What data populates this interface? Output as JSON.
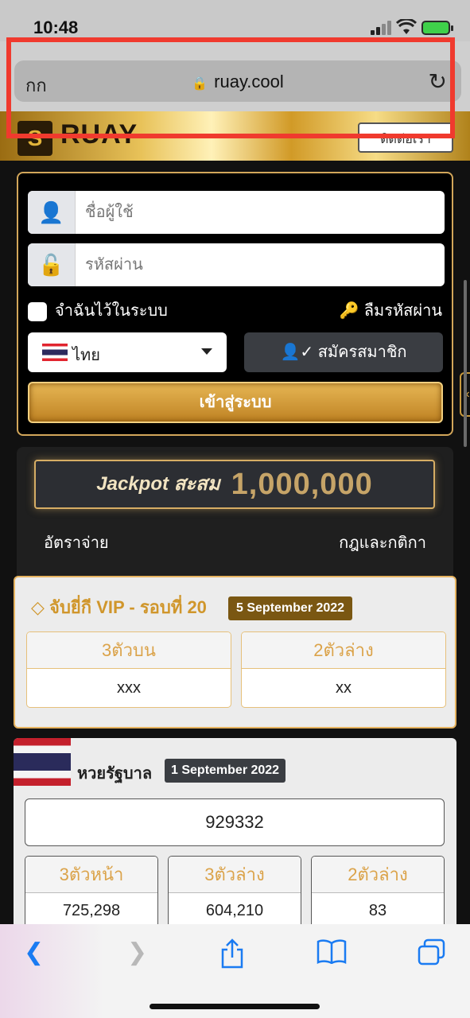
{
  "status_bar": {
    "time": "10:48"
  },
  "browser": {
    "text_size_label": "กก",
    "url": "ruay.cool"
  },
  "site": {
    "brand": "RUAY",
    "header_button": "ติดต่อเรา"
  },
  "login": {
    "username_placeholder": "ชื่อผู้ใช้",
    "password_placeholder": "รหัสผ่าน",
    "remember_label": "จำฉันไว้ในระบบ",
    "forgot_label": "ลืมรหัสผ่าน",
    "language": "ไทย",
    "register_label": "สมัครสมาชิก",
    "login_label": "เข้าสู่ระบบ"
  },
  "jackpot": {
    "label": "Jackpot สะสม",
    "value": "1,000,000",
    "rates_link": "อัตราจ่าย",
    "rules_link": "กฎและกติกา"
  },
  "vip_lottery": {
    "title": "จับยี่กี VIP - รอบที่ 20",
    "date": "5 September 2022",
    "results": [
      {
        "label": "3ตัวบน",
        "value": "xxx"
      },
      {
        "label": "2ตัวล่าง",
        "value": "xx"
      }
    ]
  },
  "government_lottery": {
    "title": "หวยรัฐบาล",
    "date": "1 September 2022",
    "first_prize": "929332",
    "results": [
      {
        "label": "3ตัวหน้า",
        "value": "725,298"
      },
      {
        "label": "3ตัวล่าง",
        "value": "604,210"
      },
      {
        "label": "2ตัวล่าง",
        "value": "83"
      }
    ]
  },
  "colors": {
    "accent_gold": "#d6ad64",
    "highlight_red": "#f03a2e",
    "ios_blue": "#1a7bf2"
  }
}
